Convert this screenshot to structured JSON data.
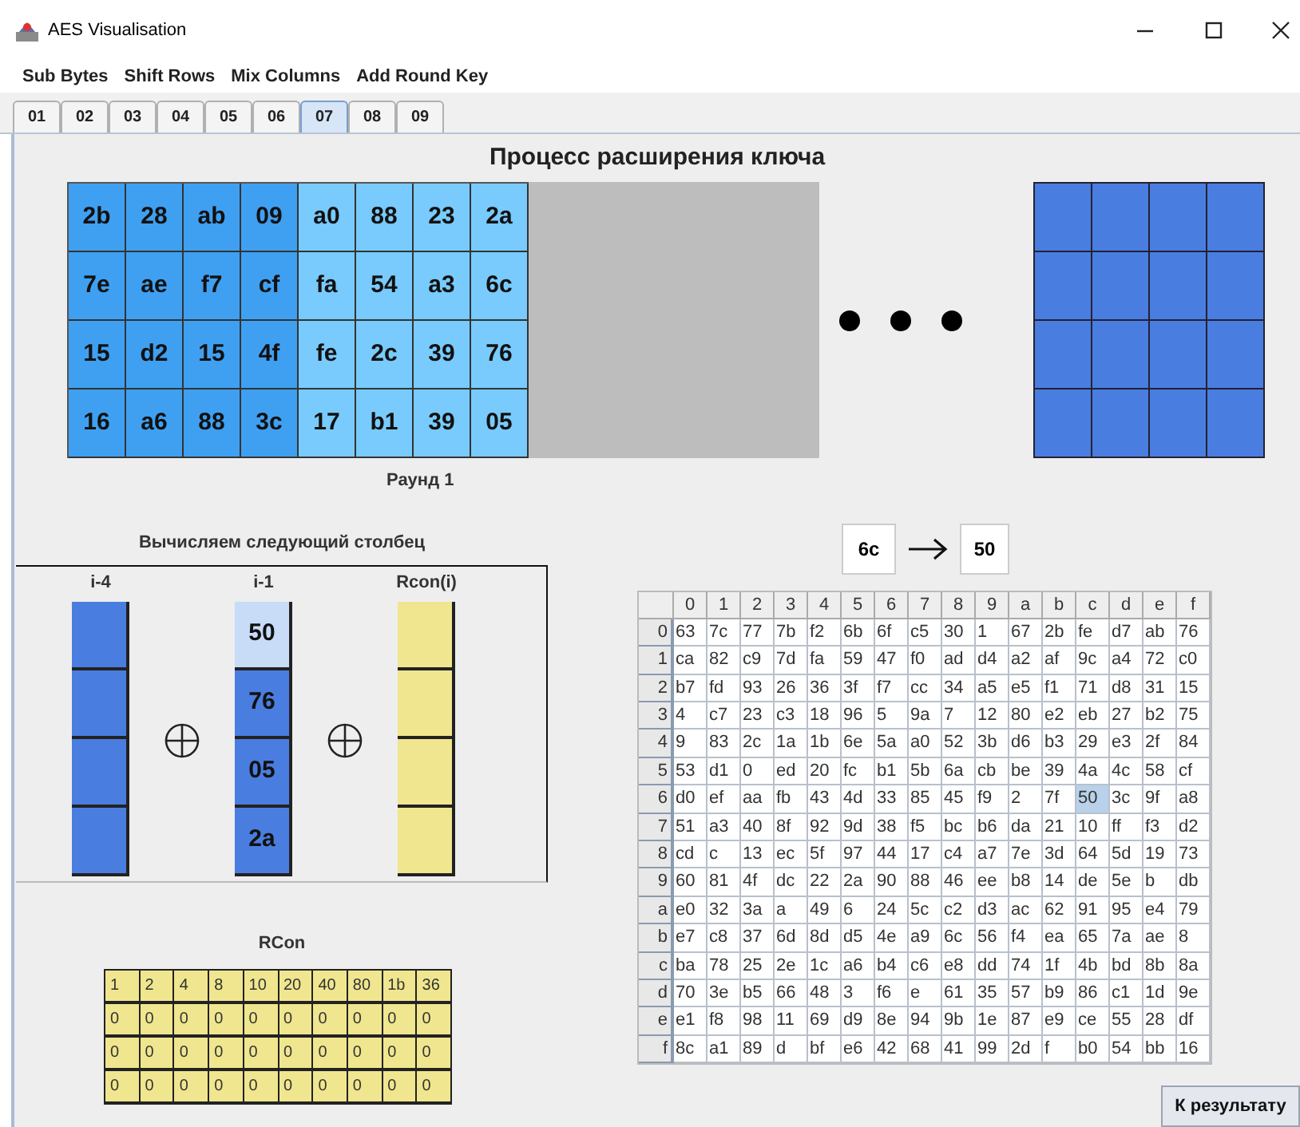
{
  "window": {
    "title": "AES Visualisation"
  },
  "menu": [
    "Sub Bytes",
    "Shift Rows",
    "Mix Columns",
    "Add Round Key"
  ],
  "tabs": [
    {
      "label": "01",
      "selected": false
    },
    {
      "label": "02",
      "selected": false
    },
    {
      "label": "03",
      "selected": false
    },
    {
      "label": "04",
      "selected": false
    },
    {
      "label": "05",
      "selected": false
    },
    {
      "label": "06",
      "selected": false
    },
    {
      "label": "07",
      "selected": true
    },
    {
      "label": "08",
      "selected": false
    },
    {
      "label": "09",
      "selected": false
    }
  ],
  "heading": "Процесс расширения ключа",
  "key_matrix": {
    "columns": [
      {
        "kind": "previous",
        "cells": [
          "2b",
          "7e",
          "15",
          "16"
        ]
      },
      {
        "kind": "previous",
        "cells": [
          "28",
          "ae",
          "d2",
          "a6"
        ]
      },
      {
        "kind": "previous",
        "cells": [
          "ab",
          "f7",
          "15",
          "88"
        ]
      },
      {
        "kind": "previous",
        "cells": [
          "09",
          "cf",
          "4f",
          "3c"
        ]
      },
      {
        "kind": "current",
        "cells": [
          "a0",
          "fa",
          "fe",
          "17"
        ]
      },
      {
        "kind": "current",
        "cells": [
          "88",
          "54",
          "2c",
          "b1"
        ]
      },
      {
        "kind": "current",
        "cells": [
          "23",
          "a3",
          "39",
          "39"
        ]
      },
      {
        "kind": "current",
        "cells": [
          "2a",
          "6c",
          "76",
          "05"
        ]
      }
    ],
    "caption": "Раунд 1"
  },
  "next_column": {
    "title": "Вычисляем следующий столбец",
    "columns": [
      {
        "label": "i-4",
        "kind": "blue",
        "cells": [
          {
            "highlighted": false
          },
          {
            "highlighted": false
          },
          {
            "highlighted": false
          },
          {
            "highlighted": false
          }
        ]
      },
      {
        "label": "i-1",
        "kind": "blue",
        "cells": [
          {
            "value": "50",
            "highlighted": true
          },
          {
            "value": "76",
            "highlighted": false
          },
          {
            "value": "05",
            "highlighted": false
          },
          {
            "value": "2a",
            "highlighted": false
          }
        ]
      },
      {
        "label": "Rcon(i)",
        "kind": "yellow",
        "cells": [
          {
            "highlighted": false
          },
          {
            "highlighted": false
          },
          {
            "highlighted": false
          },
          {
            "highlighted": false
          }
        ]
      }
    ]
  },
  "rcon": {
    "title": "RCon",
    "rows": [
      [
        "1",
        "2",
        "4",
        "8",
        "10",
        "20",
        "40",
        "80",
        "1b",
        "36"
      ],
      [
        "0",
        "0",
        "0",
        "0",
        "0",
        "0",
        "0",
        "0",
        "0",
        "0"
      ],
      [
        "0",
        "0",
        "0",
        "0",
        "0",
        "0",
        "0",
        "0",
        "0",
        "0"
      ],
      [
        "0",
        "0",
        "0",
        "0",
        "0",
        "0",
        "0",
        "0",
        "0",
        "0"
      ]
    ]
  },
  "substitution": {
    "input": "6c",
    "output": "50"
  },
  "sbox": {
    "columns": [
      "0",
      "1",
      "2",
      "3",
      "4",
      "5",
      "6",
      "7",
      "8",
      "9",
      "a",
      "b",
      "c",
      "d",
      "e",
      "f"
    ],
    "rows": [
      {
        "header": "0",
        "cells": [
          "63",
          "7c",
          "77",
          "7b",
          "f2",
          "6b",
          "6f",
          "c5",
          "30",
          "1",
          "67",
          "2b",
          "fe",
          "d7",
          "ab",
          "76"
        ]
      },
      {
        "header": "1",
        "cells": [
          "ca",
          "82",
          "c9",
          "7d",
          "fa",
          "59",
          "47",
          "f0",
          "ad",
          "d4",
          "a2",
          "af",
          "9c",
          "a4",
          "72",
          "c0"
        ]
      },
      {
        "header": "2",
        "cells": [
          "b7",
          "fd",
          "93",
          "26",
          "36",
          "3f",
          "f7",
          "cc",
          "34",
          "a5",
          "e5",
          "f1",
          "71",
          "d8",
          "31",
          "15"
        ]
      },
      {
        "header": "3",
        "cells": [
          "4",
          "c7",
          "23",
          "c3",
          "18",
          "96",
          "5",
          "9a",
          "7",
          "12",
          "80",
          "e2",
          "eb",
          "27",
          "b2",
          "75"
        ]
      },
      {
        "header": "4",
        "cells": [
          "9",
          "83",
          "2c",
          "1a",
          "1b",
          "6e",
          "5a",
          "a0",
          "52",
          "3b",
          "d6",
          "b3",
          "29",
          "e3",
          "2f",
          "84"
        ]
      },
      {
        "header": "5",
        "cells": [
          "53",
          "d1",
          "0",
          "ed",
          "20",
          "fc",
          "b1",
          "5b",
          "6a",
          "cb",
          "be",
          "39",
          "4a",
          "4c",
          "58",
          "cf"
        ]
      },
      {
        "header": "6",
        "cells": [
          "d0",
          "ef",
          "aa",
          "fb",
          "43",
          "4d",
          "33",
          "85",
          "45",
          "f9",
          "2",
          "7f",
          "50",
          "3c",
          "9f",
          "a8"
        ],
        "selected_cells": [
          false,
          false,
          false,
          false,
          false,
          false,
          false,
          false,
          false,
          false,
          false,
          false,
          true,
          false,
          false,
          false
        ]
      },
      {
        "header": "7",
        "cells": [
          "51",
          "a3",
          "40",
          "8f",
          "92",
          "9d",
          "38",
          "f5",
          "bc",
          "b6",
          "da",
          "21",
          "10",
          "ff",
          "f3",
          "d2"
        ]
      },
      {
        "header": "8",
        "cells": [
          "cd",
          "c",
          "13",
          "ec",
          "5f",
          "97",
          "44",
          "17",
          "c4",
          "a7",
          "7e",
          "3d",
          "64",
          "5d",
          "19",
          "73"
        ]
      },
      {
        "header": "9",
        "cells": [
          "60",
          "81",
          "4f",
          "dc",
          "22",
          "2a",
          "90",
          "88",
          "46",
          "ee",
          "b8",
          "14",
          "de",
          "5e",
          "b",
          "db"
        ]
      },
      {
        "header": "a",
        "cells": [
          "e0",
          "32",
          "3a",
          "a",
          "49",
          "6",
          "24",
          "5c",
          "c2",
          "d3",
          "ac",
          "62",
          "91",
          "95",
          "e4",
          "79"
        ]
      },
      {
        "header": "b",
        "cells": [
          "e7",
          "c8",
          "37",
          "6d",
          "8d",
          "d5",
          "4e",
          "a9",
          "6c",
          "56",
          "f4",
          "ea",
          "65",
          "7a",
          "ae",
          "8"
        ]
      },
      {
        "header": "c",
        "cells": [
          "ba",
          "78",
          "25",
          "2e",
          "1c",
          "a6",
          "b4",
          "c6",
          "e8",
          "dd",
          "74",
          "1f",
          "4b",
          "bd",
          "8b",
          "8a"
        ]
      },
      {
        "header": "d",
        "cells": [
          "70",
          "3e",
          "b5",
          "66",
          "48",
          "3",
          "f6",
          "e",
          "61",
          "35",
          "57",
          "b9",
          "86",
          "c1",
          "1d",
          "9e"
        ]
      },
      {
        "header": "e",
        "cells": [
          "e1",
          "f8",
          "98",
          "11",
          "69",
          "d9",
          "8e",
          "94",
          "9b",
          "1e",
          "87",
          "e9",
          "ce",
          "55",
          "28",
          "df"
        ]
      },
      {
        "header": "f",
        "cells": [
          "8c",
          "a1",
          "89",
          "d",
          "bf",
          "e6",
          "42",
          "68",
          "41",
          "99",
          "2d",
          "f",
          "b0",
          "54",
          "bb",
          "16"
        ]
      }
    ]
  },
  "result_button": "К результату"
}
